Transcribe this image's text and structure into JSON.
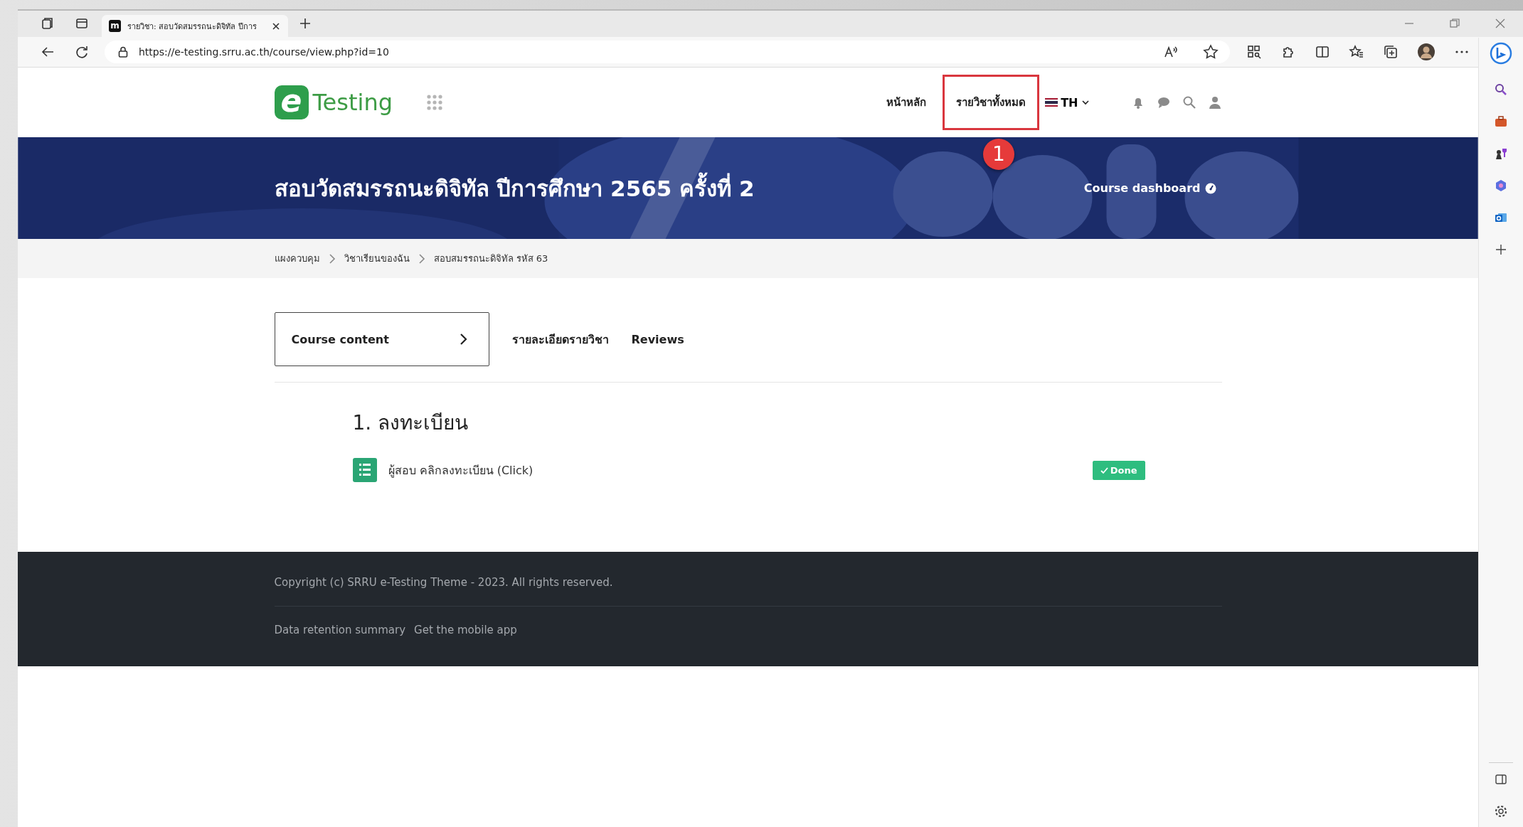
{
  "browser": {
    "tabs": [
      {
        "favicon": "m",
        "title": "รายวิชา: สอบวัดสมรรถนะดิจิทัล ปีการ",
        "selected": true
      }
    ],
    "address": "https://e-testing.srru.ac.th/course/view.php?id=10"
  },
  "site": {
    "logo_mark": "e",
    "logo_text": "Testing",
    "nav": [
      {
        "label": "หน้าหลัก",
        "highlighted": false
      },
      {
        "label": "รายวิชาทั้งหมด",
        "highlighted": true
      }
    ],
    "language": "TH"
  },
  "callout": {
    "label": "1"
  },
  "banner": {
    "title": "สอบวัดสมรรถนะดิจิทัล ปีการศึกษา 2565 ครั้งที่ 2",
    "dashboard_link": "Course dashboard"
  },
  "breadcrumb": [
    "แผงควบคุม",
    "วิชาเรียนของฉัน",
    "สอบสมรรถนะดิจิทัล รหัส 63"
  ],
  "course_tabs": [
    {
      "label": "Course content",
      "selected": true
    },
    {
      "label": "รายละเอียดรายวิชา",
      "selected": false
    },
    {
      "label": "Reviews",
      "selected": false
    }
  ],
  "sections": [
    {
      "title": "1. ลงทะเบียน",
      "activities": [
        {
          "name": "ผู้สอบ คลิกลงทะเบียน (Click)",
          "completed": true,
          "status": "Done"
        }
      ]
    }
  ],
  "footer": {
    "copyright": "Copyright (c) SRRU e-Testing Theme - 2023. All rights reserved.",
    "links": [
      "Data retention summary",
      "Get the mobile app"
    ]
  }
}
